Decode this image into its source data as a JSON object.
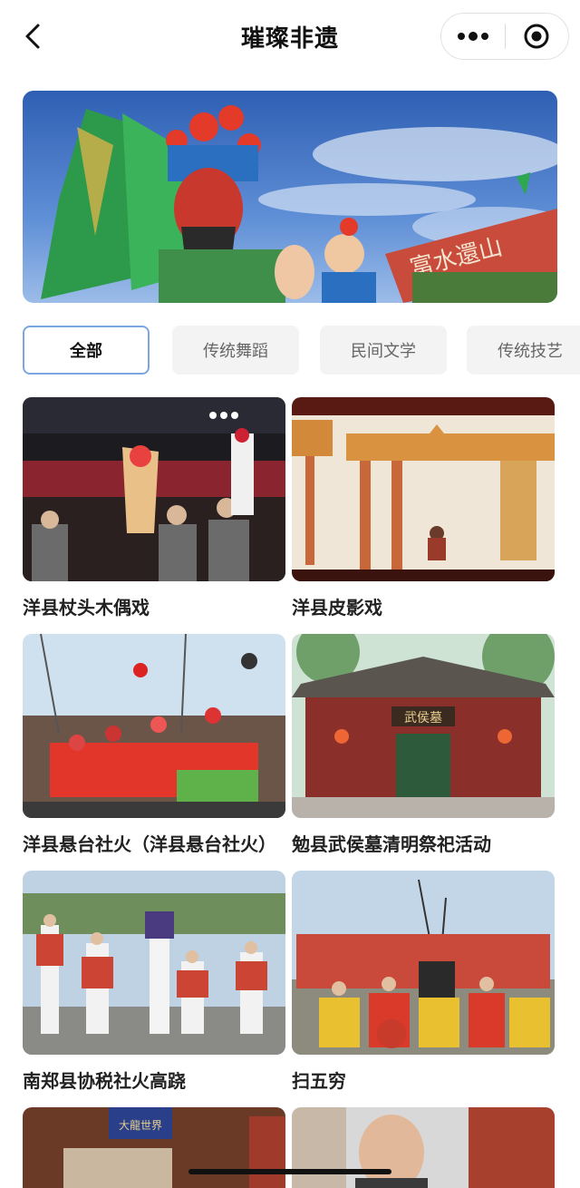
{
  "header": {
    "title": "璀璨非遗",
    "back_icon": "chevron-left-icon",
    "more_icon": "more-dots-icon",
    "close_icon": "target-circle-icon"
  },
  "banner": {
    "sign_text": "富水還山"
  },
  "tabs": [
    {
      "label": "全部",
      "active": true
    },
    {
      "label": "传统舞蹈",
      "active": false
    },
    {
      "label": "民间文学",
      "active": false
    },
    {
      "label": "传统技艺",
      "active": false
    }
  ],
  "items": [
    {
      "title": "洋县杖头木偶戏"
    },
    {
      "title": "洋县皮影戏"
    },
    {
      "title": "洋县悬台社火（洋县悬台社火）"
    },
    {
      "title": "勉县武侯墓清明祭祀活动"
    },
    {
      "title": "南郑县协税社火高跷"
    },
    {
      "title": "扫五穷"
    },
    {
      "title": ""
    },
    {
      "title": ""
    }
  ],
  "images": {
    "gate_plaque": "武侯墓",
    "poster_plaque": "大龍世界"
  },
  "colors": {
    "tab_active_border": "#7aa7e0",
    "tab_bg": "#f3f3f3"
  }
}
